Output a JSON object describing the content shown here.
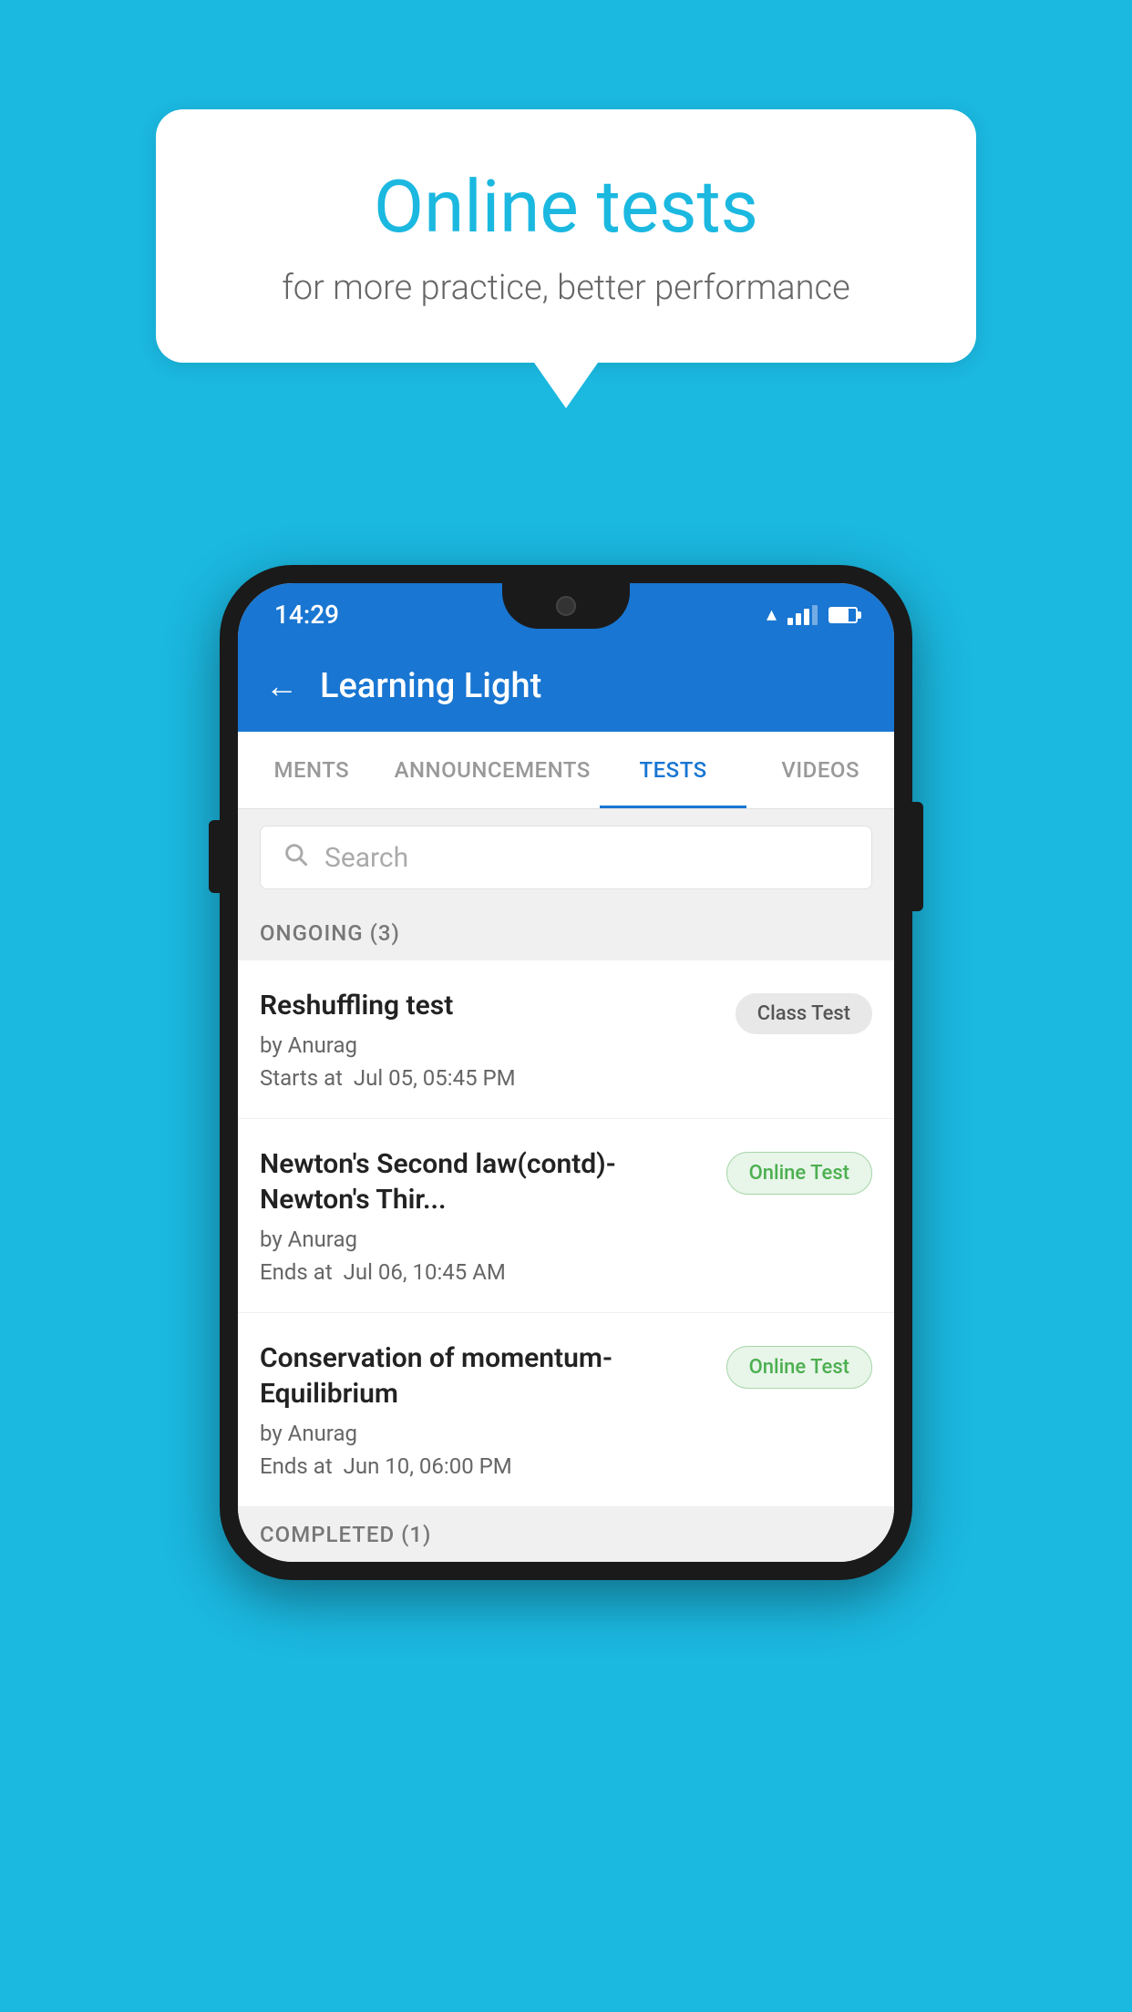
{
  "background": {
    "color": "#1BB8E0"
  },
  "speech_bubble": {
    "title": "Online tests",
    "subtitle": "for more practice, better performance"
  },
  "status_bar": {
    "time": "14:29"
  },
  "app_header": {
    "title": "Learning Light",
    "back_label": "←"
  },
  "tabs": [
    {
      "label": "MENTS",
      "active": false
    },
    {
      "label": "ANNOUNCEMENTS",
      "active": false
    },
    {
      "label": "TESTS",
      "active": true
    },
    {
      "label": "VIDEOS",
      "active": false
    }
  ],
  "search": {
    "placeholder": "Search"
  },
  "ongoing_section": {
    "label": "ONGOING (3)"
  },
  "test_items": [
    {
      "name": "Reshuffling test",
      "author": "by Anurag",
      "time_label": "Starts at",
      "time": "Jul 05, 05:45 PM",
      "badge": "Class Test",
      "badge_type": "class"
    },
    {
      "name": "Newton's Second law(contd)-Newton's Thir...",
      "author": "by Anurag",
      "time_label": "Ends at",
      "time": "Jul 06, 10:45 AM",
      "badge": "Online Test",
      "badge_type": "online"
    },
    {
      "name": "Conservation of momentum-Equilibrium",
      "author": "by Anurag",
      "time_label": "Ends at",
      "time": "Jun 10, 06:00 PM",
      "badge": "Online Test",
      "badge_type": "online"
    }
  ],
  "completed_section": {
    "label": "COMPLETED (1)"
  }
}
